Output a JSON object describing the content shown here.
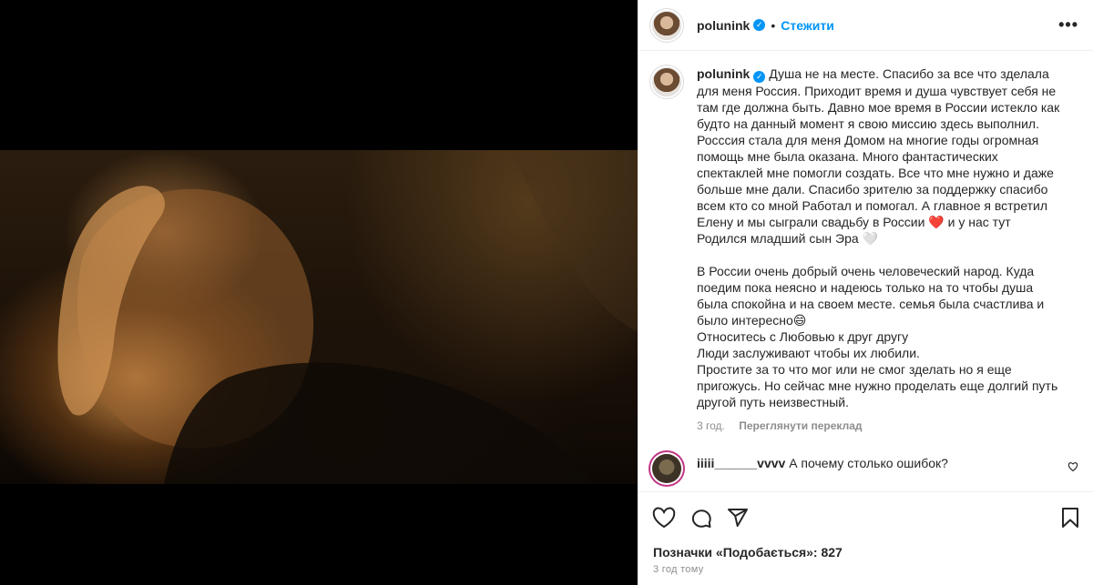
{
  "post": {
    "username": "polunink",
    "follow_label": "Стежити",
    "caption": "Душа не на месте. Спасибо за все что зделала для меня Россия. Приходит время и душа чувствует себя не там где должна быть. Давно мое время в России истекло как будто на данный момент я свою миссию здесь выполнил. Росссия стала для меня Домом на многие годы огромная помощь мне была оказана. Много фантастических спектаклей мне помогли создать. Все что мне нужно и даже больше мне дали. Спасибо зрителю за поддержку спасибо всем кто со мной Работал и помогал. А главное я встретил Елену и мы сыграли свадьбу в России ❤️ и у нас тут Родился младший сын Эра 🤍\n\nВ России очень добрый очень человеческий народ. Куда поедим пока неясно и надеюсь только на то чтобы душа была спокойна и на своем месте. семья была счастлива и было интересно😄\nОтноситесь с Любовью к друг другу\nЛюди заслуживают чтобы их любили.\nПростите за то что мог или не смог зделать но я еще пригожусь. Но сейчас мне нужно проделать еще долгий путь другой путь неизвестный.",
    "age": "3 год.",
    "translate_label": "Переглянути переклад",
    "likes_label": "Позначки «Подобається»: 827",
    "timestamp": "3 год тому"
  },
  "comment": {
    "username": "iiiii______vvvv",
    "text": "А почему столько ошибок?"
  },
  "icons": {
    "verified": "verified-badge-icon",
    "more": "more-options-icon",
    "like": "heart-icon",
    "comment": "comment-icon",
    "share": "share-icon",
    "save": "bookmark-icon"
  },
  "colors": {
    "accent": "#0095f6",
    "text": "#262626",
    "muted": "#8e8e8e"
  }
}
